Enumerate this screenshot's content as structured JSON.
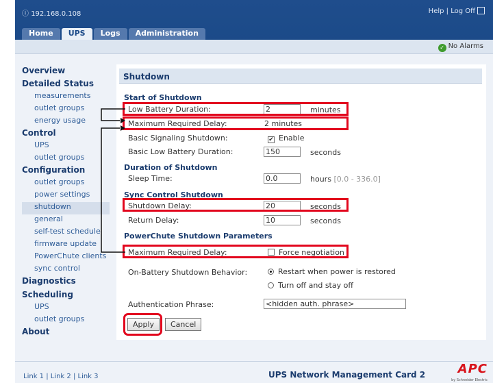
{
  "header": {
    "ip": "192.168.0.108",
    "help_logoff": "Help | Log Off",
    "tabs": [
      {
        "label": "Home"
      },
      {
        "label": "UPS"
      },
      {
        "label": "Logs"
      },
      {
        "label": "Administration"
      }
    ],
    "alarm": "No Alarms"
  },
  "sidebar": {
    "overview": "Overview",
    "detailed_status": "Detailed Status",
    "detailed_status_items": [
      "measurements",
      "outlet groups",
      "energy usage"
    ],
    "control": "Control",
    "control_items": [
      "UPS",
      "outlet groups"
    ],
    "configuration": "Configuration",
    "configuration_items": [
      "outlet groups",
      "power settings",
      "shutdown",
      "general",
      "self-test schedule",
      "firmware update",
      "PowerChute clients",
      "sync control"
    ],
    "diagnostics": "Diagnostics",
    "scheduling": "Scheduling",
    "scheduling_items": [
      "UPS",
      "outlet groups"
    ],
    "about": "About"
  },
  "main": {
    "title": "Shutdown",
    "start_heading": "Start of Shutdown",
    "low_battery_label": "Low Battery Duration:",
    "low_battery_value": "2",
    "low_battery_unit": "minutes",
    "max_delay_label": "Maximum Required Delay:",
    "max_delay_value": "2 minutes",
    "basic_signaling_label": "Basic Signaling Shutdown:",
    "basic_signaling_option": "Enable",
    "basic_low_battery_label": "Basic Low Battery Duration:",
    "basic_low_battery_value": "150",
    "basic_low_battery_unit": "seconds",
    "duration_heading": "Duration of Shutdown",
    "sleep_label": "Sleep Time:",
    "sleep_value": "0.0",
    "sleep_unit": "hours",
    "sleep_range": "[0.0 - 336.0]",
    "sync_heading": "Sync Control Shutdown",
    "shutdown_delay_label": "Shutdown Delay:",
    "shutdown_delay_value": "20",
    "shutdown_delay_unit": "seconds",
    "return_delay_label": "Return Delay:",
    "return_delay_value": "10",
    "return_delay_unit": "seconds",
    "powerchute_heading": "PowerChute Shutdown Parameters",
    "pc_max_delay_label": "Maximum Required Delay:",
    "pc_force_option": "Force negotiation",
    "battery_behavior_label": "On-Battery Shutdown Behavior:",
    "behavior_option_1": "Restart when power is restored",
    "behavior_option_2": "Turn off and stay off",
    "auth_label": "Authentication Phrase:",
    "auth_value": "<hidden auth. phrase>",
    "apply": "Apply",
    "cancel": "Cancel"
  },
  "footer": {
    "links": "Link 1 | Link 2 | Link 3",
    "card_title": "UPS Network Management Card 2",
    "logo": "APC",
    "logo_sub": "by Schneider Electric"
  },
  "colors": {
    "highlight": "#e2061d",
    "header": "#1b4a88",
    "nav": "#2f5d98"
  }
}
